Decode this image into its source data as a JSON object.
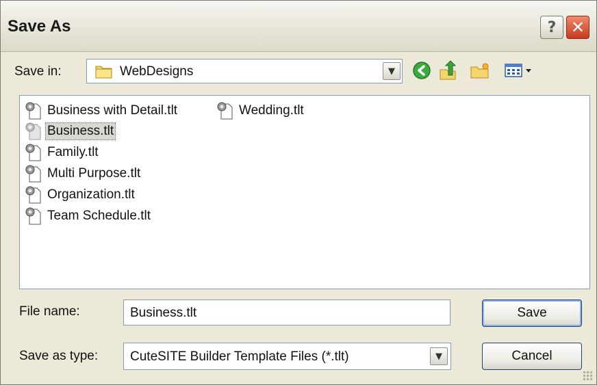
{
  "dialog": {
    "title": "Save As",
    "help_button_glyph": "?",
    "close_button_glyph": "✕"
  },
  "save_in": {
    "label": "Save in:",
    "value": "WebDesigns",
    "icon": "folder-icon"
  },
  "toolbar": {
    "icons": [
      "back-icon",
      "up-folder-icon",
      "new-folder-icon",
      "view-menu-icon"
    ]
  },
  "files": [
    {
      "name": "Business with Detail.tlt",
      "selected": false
    },
    {
      "name": "Wedding.tlt",
      "selected": false
    },
    {
      "name": "Business.tlt",
      "selected": true
    },
    {
      "name": "Family.tlt",
      "selected": false
    },
    {
      "name": "Multi Purpose.tlt",
      "selected": false
    },
    {
      "name": "Organization.tlt",
      "selected": false
    },
    {
      "name": "Team Schedule.tlt",
      "selected": false
    }
  ],
  "file_name": {
    "label": "File name:",
    "value": "Business.tlt"
  },
  "save_as_type": {
    "label": "Save as type:",
    "value": "CuteSITE Builder Template Files (*.tlt)"
  },
  "buttons": {
    "save": "Save",
    "cancel": "Cancel"
  }
}
